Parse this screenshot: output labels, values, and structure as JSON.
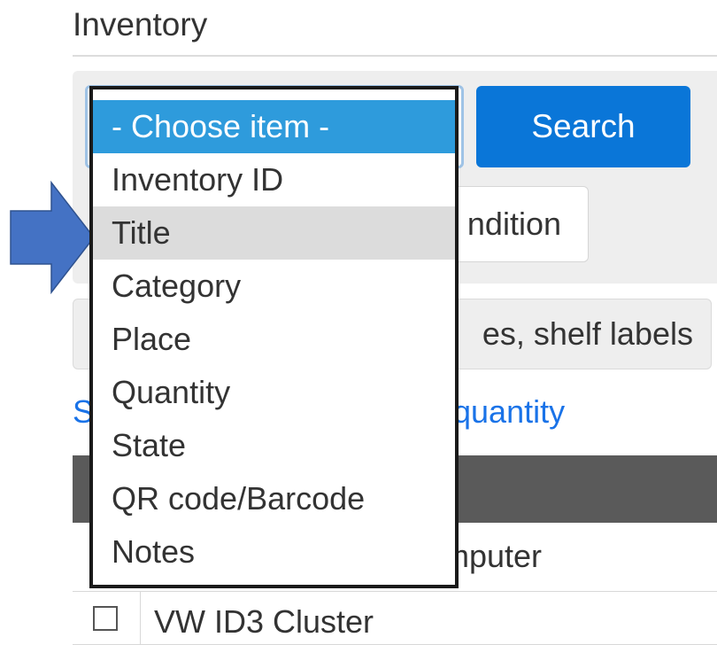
{
  "page": {
    "title": "Inventory"
  },
  "search": {
    "button_label": "Search",
    "condition_label": "ndition",
    "input_visible_text": "es, shelf labels"
  },
  "links": {
    "left_fragment": "S",
    "right_fragment": "quantity"
  },
  "table": {
    "rows": [
      {
        "name_fragment": "mputer"
      },
      {
        "name": "VW ID3 Cluster"
      }
    ]
  },
  "dropdown": {
    "selected_value": "- Choose item -",
    "hovered_option": "Title",
    "options": [
      "- Choose item -",
      "Inventory ID",
      "Title",
      "Category",
      "Place",
      "Quantity",
      "State",
      "QR code/Barcode",
      "Notes"
    ]
  },
  "colors": {
    "accent": "#0a76d8",
    "dropdown_selected": "#2e9bdc",
    "dropdown_hover": "#dcdcdc",
    "arrow_fill": "#4472c4",
    "table_header": "#5a5a5a"
  },
  "icons": {
    "pointer": "right-arrow-icon"
  }
}
